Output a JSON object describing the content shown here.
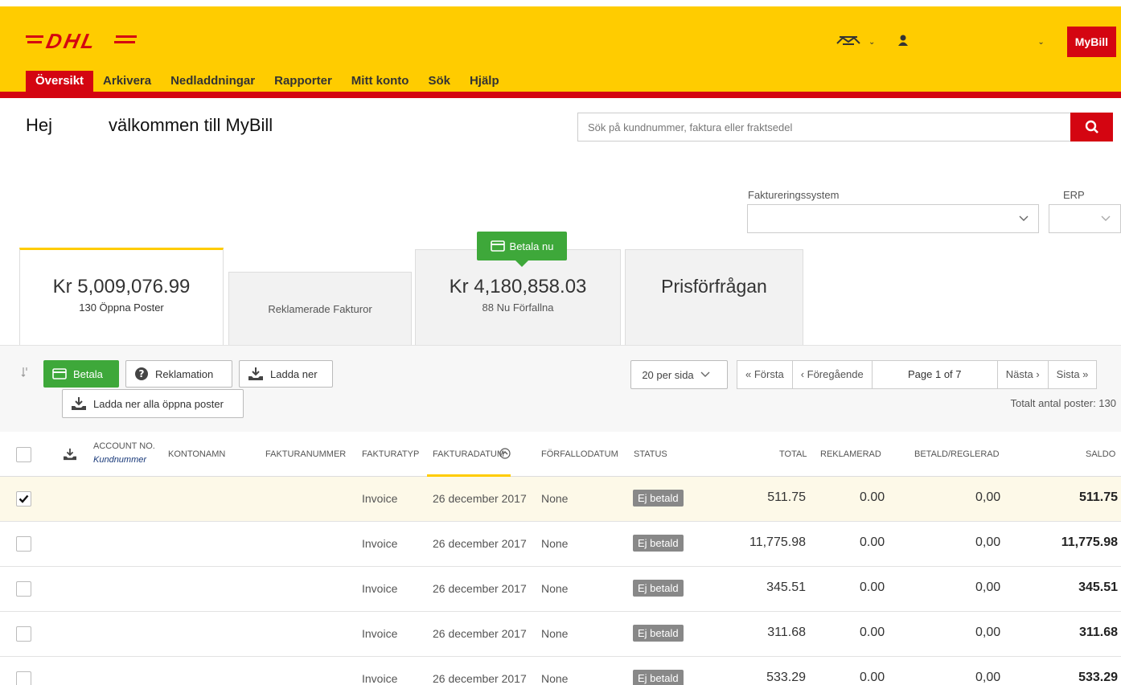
{
  "header": {
    "logo_text": "DHL",
    "nav": [
      "Översikt",
      "Arkivera",
      "Nedladdningar",
      "Rapporter",
      "Mitt konto",
      "Sök",
      "Hjälp"
    ],
    "active_nav": 0,
    "app_button": "MyBill",
    "brand_yellow": "#ffcc00",
    "brand_red": "#d40511"
  },
  "greeting": {
    "hello": "Hej",
    "welcome": "välkommen till MyBill"
  },
  "search": {
    "placeholder": "Sök på kundnummer, faktura eller fraktsedel"
  },
  "filters": {
    "billing_label": "Faktureringssystem",
    "erp_label": "ERP"
  },
  "tabs": {
    "open": {
      "amount": "Kr 5,009,076.99",
      "sub": "130 Öppna Poster"
    },
    "disputed": {
      "label": "Reklamerade Fakturor"
    },
    "due": {
      "amount": "Kr 4,180,858.03",
      "sub": "88 Nu Förfallna"
    },
    "quote": {
      "label": "Prisförfrågan"
    },
    "pay_now": "Betala nu"
  },
  "toolbar": {
    "pay": "Betala",
    "claim": "Reklamation",
    "download": "Ladda ner",
    "download_all": "Ladda ner alla öppna poster",
    "per_page": "20 per sida",
    "first": "« Första",
    "prev": "‹ Föregående",
    "page": "Page 1 of 7",
    "next": "Nästa ›",
    "last": "Sista »",
    "total": "Totalt antal poster: 130"
  },
  "table": {
    "headers": {
      "account_no": "ACCOUNT NO.",
      "account_sub": "Kundnummer",
      "account_name": "KONTONAMN",
      "invoice_no": "FAKTURANUMMER",
      "invoice_type": "FAKTURATYP",
      "invoice_date": "FAKTURADATUM",
      "due_date": "FÖRFALLODATUM",
      "status": "STATUS",
      "total": "TOTAL",
      "disputed": "REKLAMERAD",
      "paid": "BETALD/REGLERAD",
      "balance": "SALDO"
    },
    "rows": [
      {
        "type": "Invoice",
        "date": "26 december 2017",
        "due": "None",
        "status": "Ej betald",
        "total": "511.75",
        "disputed": "0.00",
        "paid": "0,00",
        "balance": "511.75",
        "checked": true
      },
      {
        "type": "Invoice",
        "date": "26 december 2017",
        "due": "None",
        "status": "Ej betald",
        "total": "11,775.98",
        "disputed": "0.00",
        "paid": "0,00",
        "balance": "11,775.98",
        "checked": false
      },
      {
        "type": "Invoice",
        "date": "26 december 2017",
        "due": "None",
        "status": "Ej betald",
        "total": "345.51",
        "disputed": "0.00",
        "paid": "0,00",
        "balance": "345.51",
        "checked": false
      },
      {
        "type": "Invoice",
        "date": "26 december 2017",
        "due": "None",
        "status": "Ej betald",
        "total": "311.68",
        "disputed": "0.00",
        "paid": "0,00",
        "balance": "311.68",
        "checked": false
      },
      {
        "type": "Invoice",
        "date": "26 december 2017",
        "due": "None",
        "status": "Ej betald",
        "total": "533.29",
        "disputed": "0.00",
        "paid": "0,00",
        "balance": "533.29",
        "checked": false
      }
    ]
  }
}
